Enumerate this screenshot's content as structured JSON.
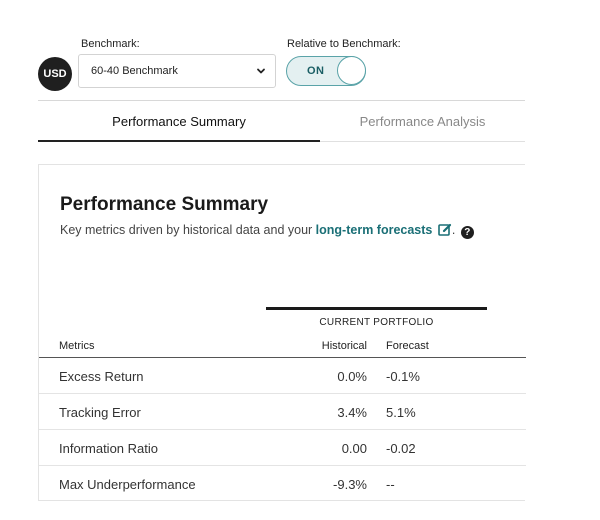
{
  "currency": "USD",
  "benchmark": {
    "label": "Benchmark:",
    "selected": "60-40 Benchmark"
  },
  "relative": {
    "label": "Relative to Benchmark:",
    "toggle_text": "ON"
  },
  "tabs": [
    {
      "label": "Performance Summary",
      "active": true
    },
    {
      "label": "Performance Analysis",
      "active": false
    }
  ],
  "summary": {
    "title": "Performance Summary",
    "subtitle_prefix": "Key metrics driven by historical data and your ",
    "subtitle_link": "long-term forecasts",
    "subtitle_suffix": "."
  },
  "table": {
    "group_label": "CURRENT PORTFOLIO",
    "columns": {
      "metrics": "Metrics",
      "historical": "Historical",
      "forecast": "Forecast"
    },
    "rows": [
      {
        "metric": "Excess Return",
        "historical": "0.0%",
        "forecast": "-0.1%"
      },
      {
        "metric": "Tracking Error",
        "historical": "3.4%",
        "forecast": "5.1%"
      },
      {
        "metric": "Information Ratio",
        "historical": "0.00",
        "forecast": "-0.02"
      },
      {
        "metric": "Max Underperformance",
        "historical": "-9.3%",
        "forecast": "--"
      }
    ]
  },
  "colors": {
    "accent": "#1a6f76",
    "toggle_bg": "#e4f0f1",
    "toggle_border": "#5aa3a8"
  }
}
